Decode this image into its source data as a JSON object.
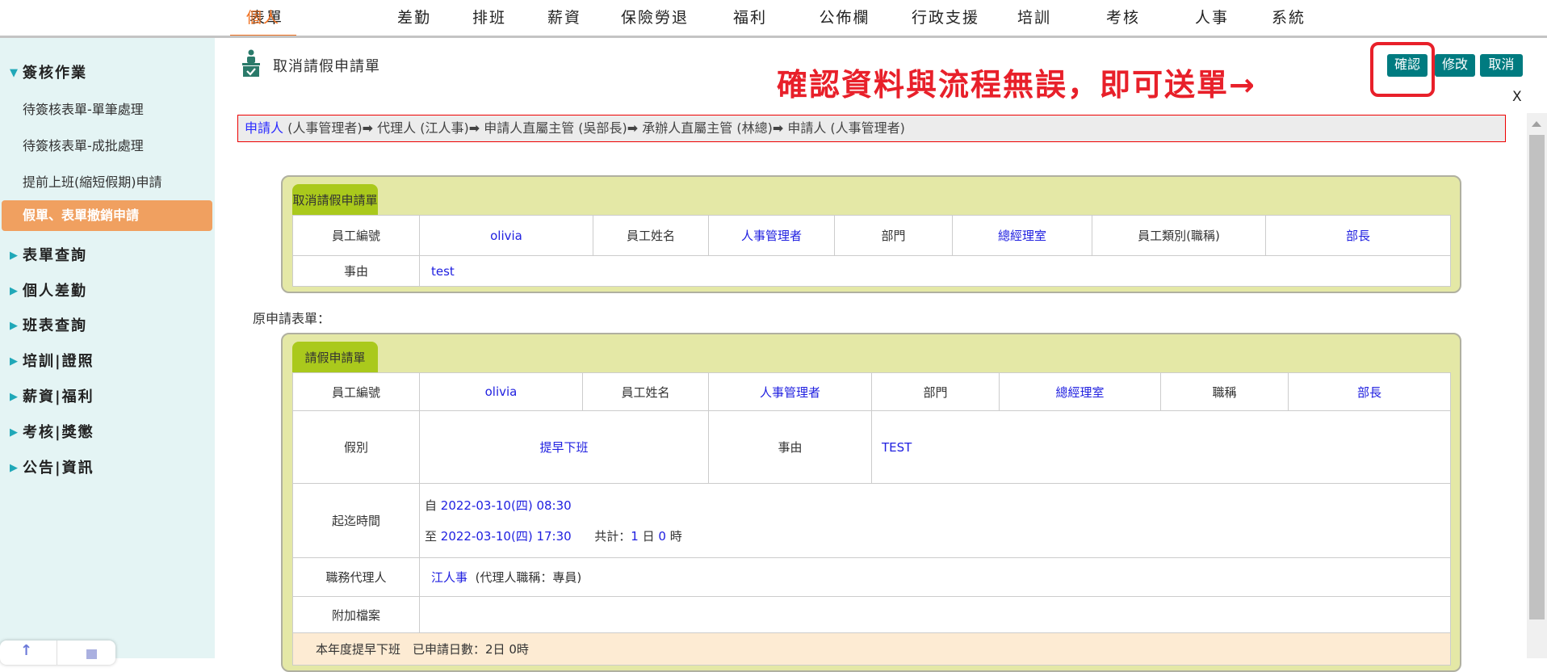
{
  "nav": {
    "items": [
      "表單",
      "個人",
      "差勤",
      "排班",
      "薪資",
      "保險勞退",
      "福利",
      "公佈欄",
      "行政支援",
      "培訓",
      "考核",
      "人事",
      "系統"
    ],
    "active": "個人"
  },
  "sidebar": {
    "group_open": "簽核作業",
    "subs": [
      "待簽核表單-單筆處理",
      "待簽核表單-成批處理",
      "提前上班(縮短假期)申請",
      "假單、表單撤銷申請"
    ],
    "groups": [
      "表單查詢",
      "個人差勤",
      "班表查詢",
      "培訓|證照",
      "薪資|福利",
      "考核|獎懲",
      "公告|資訊"
    ]
  },
  "page": {
    "title": "取消請假申請單",
    "notice": "確認資料與流程無誤，即可送單→",
    "buttons": {
      "confirm": "確認",
      "edit": "修改",
      "cancel": "取消"
    },
    "close": "X"
  },
  "flow": {
    "steps": [
      "申請人",
      "(人事管理者)",
      "代理人 (江人事)",
      "申請人直屬主管 (吳部長)",
      "承辦人直屬主管 (林總)",
      "申請人 (人事管理者)"
    ]
  },
  "cancel_form": {
    "tab": "取消請假申請單",
    "row1": [
      "員工編號",
      "olivia",
      "員工姓名",
      "人事管理者",
      "部門",
      "總經理室",
      "員工類別(職稱)",
      "部長"
    ],
    "reason_label": "事由",
    "reason": "test"
  },
  "orig_label": "原申請表單：",
  "leave_form": {
    "tab": "請假申請單",
    "row1": [
      "員工編號",
      "olivia",
      "員工姓名",
      "人事管理者",
      "部門",
      "總經理室",
      "職稱",
      "部長"
    ],
    "type_label": "假別",
    "type": "提早下班",
    "reason_label": "事由",
    "reason": "TEST",
    "time_label": "起迄時間",
    "from_prefix": "自",
    "from": "2022-03-10(四) 08:30",
    "to_prefix": "至",
    "to": "2022-03-10(四) 17:30",
    "total_label": "共計：",
    "days": "1",
    "day_unit": "日",
    "hours": "0",
    "hour_unit": "時",
    "agent_label": "職務代理人",
    "agent": "江人事",
    "agent_title": "(代理人職稱：專員)",
    "attach_label": "附加檔案",
    "summary": "本年度提早下班　已申請日數：2日 0時"
  },
  "colors": {
    "accent": "#007b80",
    "nav_active": "#f07020",
    "tab": "#aac91c",
    "panel": "#e4e8a6",
    "notice": "#e8202a"
  }
}
